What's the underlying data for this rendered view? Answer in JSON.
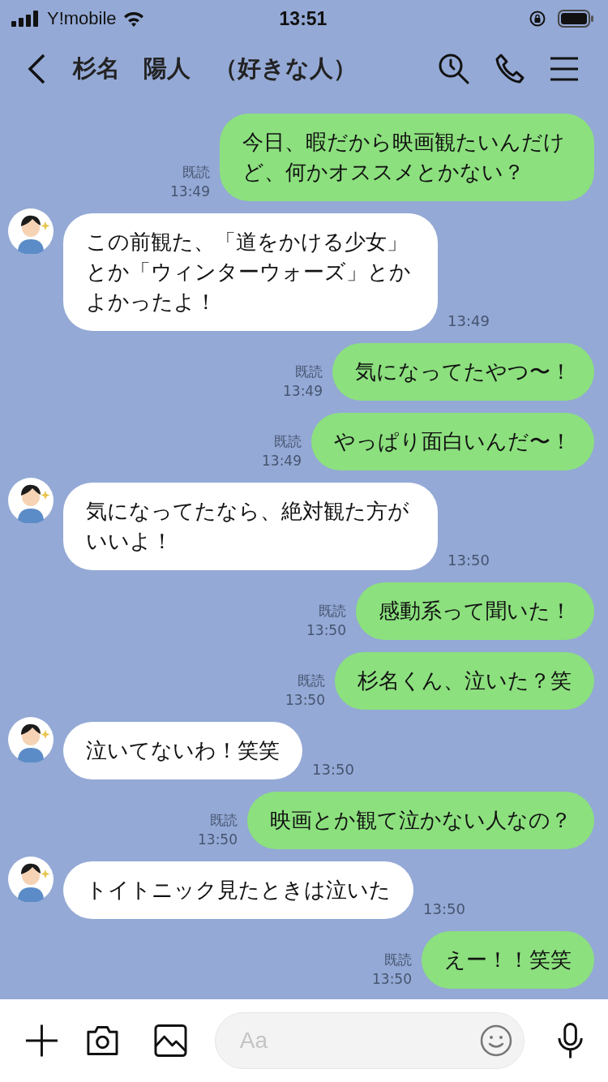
{
  "status_bar": {
    "carrier": "Y!mobile",
    "time": "13:51"
  },
  "header": {
    "title": "杉名　陽人　（好きな人）"
  },
  "messages": [
    {
      "kind": "sent",
      "text": "今日、暇だから映画観たいんだけど、何かオススメとかない？",
      "read": "既読",
      "time": "13:49"
    },
    {
      "kind": "received",
      "text": "この前観た、「道をかける少女」とか「ウィンターウォーズ」とかよかったよ！",
      "time": "13:49"
    },
    {
      "kind": "sent",
      "text": "気になってたやつ〜！",
      "read": "既読",
      "time": "13:49"
    },
    {
      "kind": "sent",
      "text": "やっぱり面白いんだ〜！",
      "read": "既読",
      "time": "13:49"
    },
    {
      "kind": "received",
      "text": "気になってたなら、絶対観た方がいいよ！",
      "time": "13:50"
    },
    {
      "kind": "sent",
      "text": "感動系って聞いた！",
      "read": "既読",
      "time": "13:50"
    },
    {
      "kind": "sent",
      "text": "杉名くん、泣いた？笑",
      "read": "既読",
      "time": "13:50"
    },
    {
      "kind": "received",
      "text": "泣いてないわ！笑笑",
      "time": "13:50"
    },
    {
      "kind": "sent",
      "text": "映画とか観て泣かない人なの？",
      "read": "既読",
      "time": "13:50"
    },
    {
      "kind": "received",
      "text": "トイトニック見たときは泣いた",
      "time": "13:50"
    },
    {
      "kind": "sent",
      "text": "えー！！笑笑",
      "read": "既読",
      "time": "13:50"
    }
  ],
  "input": {
    "placeholder": "Aa"
  }
}
